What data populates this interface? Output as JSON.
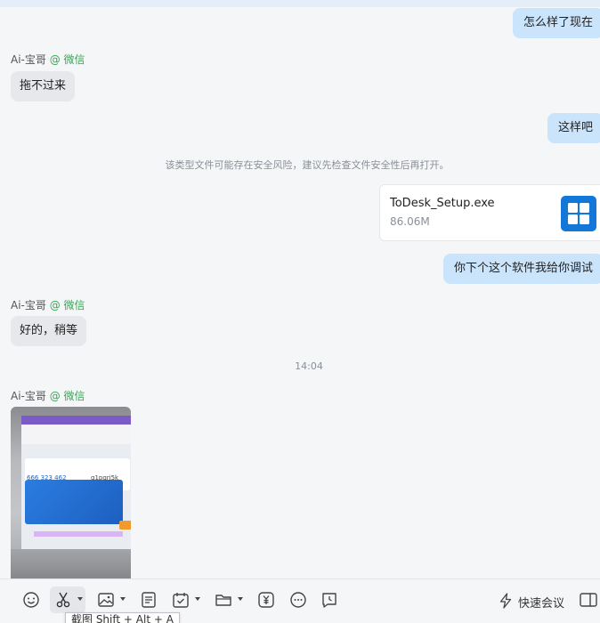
{
  "messages": {
    "out_1": "怎么样了现在",
    "sender_1": {
      "name": "Ai-宝哥",
      "platform": "@ 微信"
    },
    "in_1": "拖不过来",
    "out_2": "这样吧",
    "system_notice": "该类型文件可能存在安全风险，建议先检查文件安全性后再打开。",
    "file": {
      "name": "ToDesk_Setup.exe",
      "size": "86.06M",
      "icon": "windows-app-icon"
    },
    "out_3": "你下个这个软件我给你调试",
    "sender_2": {
      "name": "Ai-宝哥",
      "platform": "@ 微信"
    },
    "in_2": "好的，稍等",
    "time": "14:04",
    "sender_3": {
      "name": "Ai-宝哥",
      "platform": "@ 微信"
    },
    "photo": {
      "code_1": "666 323 462",
      "code_2": "q1pqrj5k"
    }
  },
  "toolbar": {
    "icons": [
      "emoji-icon",
      "scissors-icon",
      "image-icon",
      "document-icon",
      "task-icon",
      "folder-icon",
      "red-packet-icon",
      "more-icon",
      "history-icon"
    ],
    "meeting_label": "快速会议",
    "tooltip": "截图 Shift + Alt + A"
  },
  "colors": {
    "outgoing_bubble": "#c9e4fb",
    "incoming_bubble": "#e6e8eb",
    "wechat_green": "#33a853",
    "file_icon_blue": "#1277d6"
  }
}
